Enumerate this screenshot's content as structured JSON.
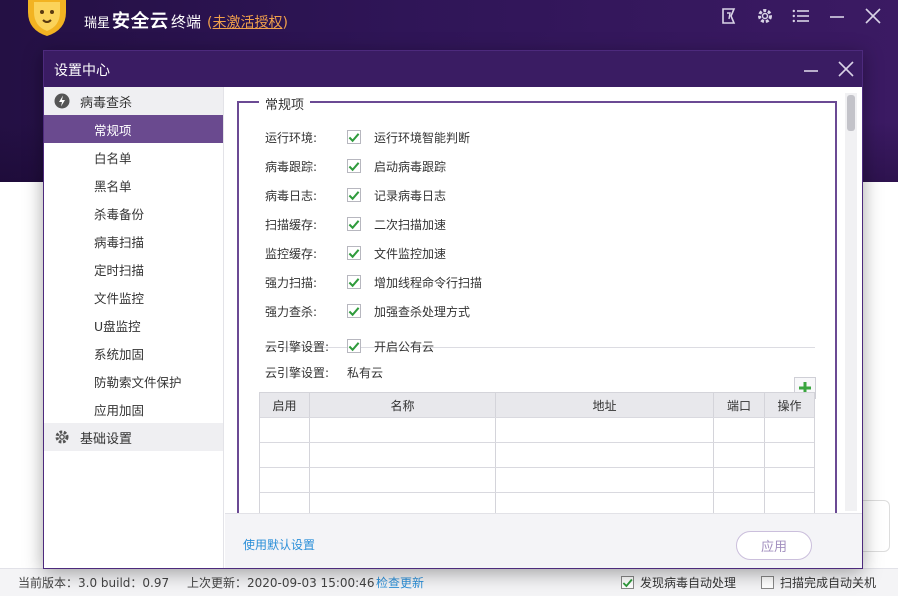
{
  "app": {
    "brand_small": "瑞星",
    "brand_big": "安全云",
    "brand_sub": "终端",
    "license_open": "(",
    "license": "未激活授权",
    "license_close": ")"
  },
  "dialog": {
    "title": "设置中心"
  },
  "sidebar": {
    "group_virus": "病毒查杀",
    "items": [
      "常规项",
      "白名单",
      "黑名单",
      "杀毒备份",
      "病毒扫描",
      "定时扫描",
      "文件监控",
      "U盘监控",
      "系统加固",
      "防勒索文件保护",
      "应用加固"
    ],
    "group_basic": "基础设置"
  },
  "general": {
    "legend": "常规项",
    "rows": [
      {
        "label": "运行环境:",
        "option": "运行环境智能判断"
      },
      {
        "label": "病毒跟踪:",
        "option": "启动病毒跟踪"
      },
      {
        "label": "病毒日志:",
        "option": "记录病毒日志"
      },
      {
        "label": "扫描缓存:",
        "option": "二次扫描加速"
      },
      {
        "label": "监控缓存:",
        "option": "文件监控加速"
      },
      {
        "label": "强力扫描:",
        "option": "增加线程命令行扫描"
      },
      {
        "label": "强力查杀:",
        "option": "加强查杀处理方式"
      }
    ],
    "cloud_public_label": "云引擎设置:",
    "cloud_public_option": "开启公有云",
    "cloud_private_label": "云引擎设置:",
    "cloud_private_value": "私有云"
  },
  "table": {
    "headers": [
      "启用",
      "名称",
      "地址",
      "端口",
      "操作"
    ]
  },
  "footer": {
    "default_link": "使用默认设置",
    "apply": "应用"
  },
  "status": {
    "version": "当前版本：3.0   build：0.97",
    "last_update": "上次更新：2020-09-03 15:00:46",
    "check_update": "检查更新",
    "auto_handle": "发现病毒自动处理",
    "auto_shutdown": "扫描完成自动关机"
  },
  "colors": {
    "header_bg": "#2f1557",
    "dialog_title_bg": "#3a1c63",
    "sidebar_active": "#6a4a8f",
    "check_green": "#2f9b3c",
    "link_blue": "#2b8fd8",
    "license_orange": "#f0a04b"
  }
}
